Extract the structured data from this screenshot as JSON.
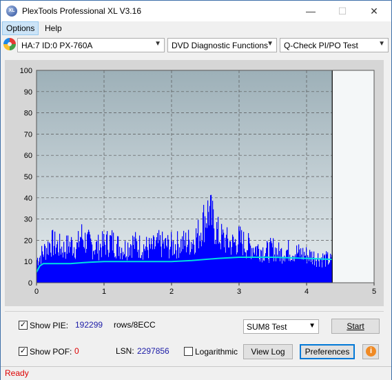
{
  "window": {
    "title": "PlexTools Professional XL V3.16",
    "icon": "xl-logo-icon"
  },
  "menu": [
    {
      "label": "Options"
    },
    {
      "label": "Help"
    }
  ],
  "toolbar": {
    "drive": "HA:7 ID:0  PX-760A",
    "function": "DVD Diagnostic Functions",
    "test": "Q-Check PI/PO Test"
  },
  "chart_data": {
    "type": "bar",
    "xlim": [
      0,
      5
    ],
    "ylim": [
      0,
      100
    ],
    "x_ticks": [
      0,
      1,
      2,
      3,
      4,
      5
    ],
    "y_ticks": [
      0,
      10,
      20,
      30,
      40,
      50,
      60,
      70,
      80,
      90,
      100
    ],
    "grid": true,
    "data_end_x": 4.38,
    "bar_color": "#0000ff",
    "line_color": "#00e0e0",
    "series": [
      {
        "x": [
          0,
          0.1,
          0.2,
          0.3,
          0.4,
          0.5,
          0.6,
          0.65,
          0.7,
          0.8,
          0.9,
          1.0,
          1.1,
          1.2,
          1.3,
          1.4,
          1.5,
          1.6,
          1.7,
          1.8,
          1.9,
          2.0,
          2.1,
          2.2,
          2.3,
          2.4,
          2.45,
          2.5,
          2.55,
          2.6,
          2.7,
          2.8,
          2.9,
          3.0,
          3.1,
          3.2,
          3.3,
          3.4,
          3.5,
          3.6,
          3.7,
          3.8,
          3.9,
          4.0,
          4.1,
          4.2,
          4.3,
          4.38
        ],
        "values": [
          15,
          20,
          26,
          24,
          22,
          25,
          23,
          31,
          28,
          24,
          23,
          25,
          27,
          24,
          22,
          26,
          24,
          23,
          22,
          25,
          24,
          24,
          25,
          26,
          27,
          32,
          38,
          43,
          47,
          40,
          30,
          27,
          25,
          28,
          24,
          23,
          22,
          20,
          22,
          19,
          21,
          20,
          19,
          18,
          17,
          16,
          15,
          14
        ]
      },
      {
        "x": [
          0,
          0.05,
          0.1,
          0.2,
          0.3,
          0.5,
          0.7,
          1.0,
          1.5,
          2.0,
          2.3,
          2.5,
          2.7,
          3.0,
          3.5,
          4.0,
          4.38
        ],
        "values": [
          5,
          8,
          9,
          9,
          9,
          9,
          9.5,
          10,
          10,
          10,
          10.5,
          11,
          11.5,
          12,
          12,
          11.5,
          11
        ]
      }
    ]
  },
  "bottom": {
    "show_pie_label": "Show PIE:",
    "pie_value": "192299",
    "pie_unit": "rows/8ECC",
    "show_pof_label": "Show POF:",
    "pof_value": "0",
    "lsn_label": "LSN:",
    "lsn_value": "2297856",
    "logarithmic_label": "Logarithmic",
    "test_select": "SUM8 Test",
    "start_label": "Start",
    "view_log_label": "View Log",
    "preferences_label": "Preferences",
    "info_icon": "info-icon"
  },
  "status": {
    "text": "Ready"
  }
}
